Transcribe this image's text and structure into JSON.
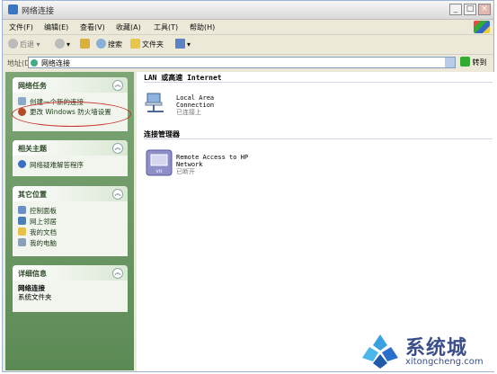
{
  "window": {
    "title": "网络连接"
  },
  "menu": [
    "文件(F)",
    "编辑(E)",
    "查看(V)",
    "收藏(A)",
    "工具(T)",
    "帮助(H)"
  ],
  "toolbar": {
    "back": "后退",
    "search": "搜索",
    "folders": "文件夹"
  },
  "address": {
    "label": "地址(D)",
    "value": "网络连接",
    "go": "转到"
  },
  "sidebar": {
    "network_tasks": {
      "title": "网络任务",
      "items": [
        "创建一个新的连接",
        "更改 Windows 防火墙设置"
      ]
    },
    "related": {
      "title": "相关主题",
      "items": [
        "网络疑难解答程序"
      ]
    },
    "other_places": {
      "title": "其它位置",
      "items": [
        "控制面板",
        "网上邻居",
        "我的文档",
        "我的电脑"
      ]
    },
    "details": {
      "title": "详细信息",
      "name": "网络连接",
      "type": "系统文件夹"
    }
  },
  "content": {
    "lan_section": "LAN 或高速 Internet",
    "lan_item": {
      "name1": "Local Area",
      "name2": "Connection",
      "status": "已连接上"
    },
    "manager_section": "连接管理器",
    "vpn_item": {
      "name1": "Remote Access to HP",
      "name2": "Network",
      "status": "已断开"
    }
  },
  "watermark": {
    "brand": "系统城",
    "url": "xitongcheng.com"
  },
  "colors": {
    "sidebar": "#6f9a68",
    "highlight_circle": "#c9302a",
    "brand": "#3a4f8a"
  }
}
